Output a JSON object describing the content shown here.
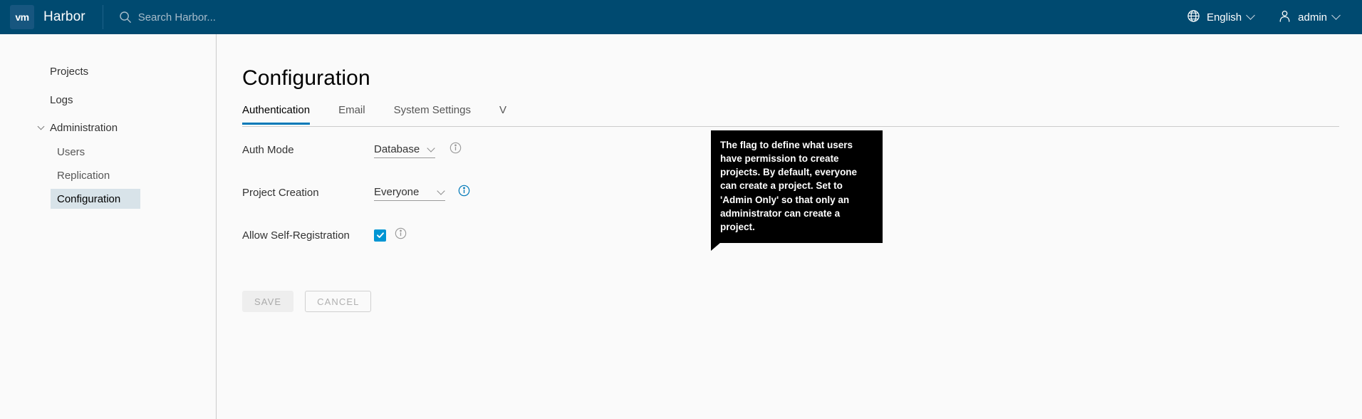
{
  "header": {
    "logo_text": "vm",
    "brand": "Harbor",
    "search": {
      "placeholder": "Search Harbor...",
      "value": "",
      "icon": "search-icon"
    },
    "language": {
      "label": "English",
      "icon": "globe-icon"
    },
    "user": {
      "label": "admin",
      "icon": "user-icon"
    },
    "background_color": "#004a70"
  },
  "sidebar": {
    "items": [
      {
        "label": "Projects",
        "level": 1,
        "selected": false,
        "expandable": false
      },
      {
        "label": "Logs",
        "level": 1,
        "selected": false,
        "expandable": false
      },
      {
        "label": "Administration",
        "level": 1,
        "selected": false,
        "expandable": true
      },
      {
        "label": "Users",
        "level": 2,
        "selected": false,
        "expandable": false
      },
      {
        "label": "Replication",
        "level": 2,
        "selected": false,
        "expandable": false
      },
      {
        "label": "Configuration",
        "level": 2,
        "selected": true,
        "expandable": false
      }
    ],
    "selected_background": "#d8e3e9"
  },
  "main": {
    "page_title": "Configuration",
    "tabs": [
      {
        "label": "Authentication",
        "active": true
      },
      {
        "label": "Email",
        "active": false
      },
      {
        "label": "System Settings",
        "active": false
      },
      {
        "label": "V",
        "active": false
      }
    ],
    "active_tab_color": "#0079b8",
    "fields": {
      "auth_mode": {
        "label": "Auth Mode",
        "value": "Database",
        "info_icon": "info-circle-icon",
        "info_icon_state": "grey"
      },
      "project_creation": {
        "label": "Project Creation",
        "value": "Everyone",
        "info_icon": "info-circle-icon",
        "info_icon_state": "blue"
      },
      "allow_self_registration": {
        "label": "Allow Self-Registration",
        "checked": true,
        "checkbox_color": "#0095d3",
        "info_icon": "info-circle-icon",
        "info_icon_state": "grey"
      }
    },
    "buttons": {
      "save": "SAVE",
      "cancel": "CANCEL"
    }
  },
  "tooltip": {
    "text": "The flag to define what users have permission to create projects. By default, everyone can create a project. Set to 'Admin Only' so that only an administrator can create a project.",
    "background_color": "#000000",
    "text_color": "#ffffff"
  }
}
